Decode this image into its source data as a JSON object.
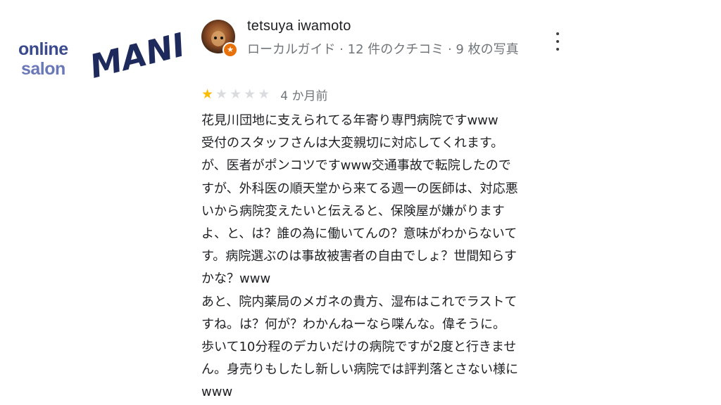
{
  "watermark": {
    "online": "online",
    "salon": "salon",
    "mania": "MANIA",
    "color_dark": "#1f2a5c",
    "color_mid": "#3a4a8c",
    "color_light": "#6a78b8"
  },
  "review": {
    "author": "tetsuya iwamoto",
    "meta": "ローカルガイド · 12 件のクチコミ · 9 枚の写真",
    "avatar_icon": "dog-photo-avatar",
    "badge_icon": "local-guide-star-icon",
    "menu_icon": "more-vert-icon",
    "rating": 1,
    "rating_max": 5,
    "date": "4 か月前",
    "star_color": "#fbbc04",
    "lines": [
      "花見川団地に支えられてる年寄り専門病院ですwww",
      "受付のスタッフさんは大変親切に対応してくれます。",
      "が、医者がポンコツですwww交通事故で転院したので",
      "すが、外科医の順天堂から来てる週一の医師は、対応悪",
      "いから病院変えたいと伝えると、保険屋が嫌がります",
      "よ、と、は？誰の為に働いてんの？意味がわからないて",
      "す。病院選ぶのは事故被害者の自由でしょ？世間知らす",
      "かな？www",
      "あと、院内薬局のメガネの貴方、湿布はこれでラストて",
      "すね。は？何が？わかんねーなら喋んな。偉そうに。",
      "歩いて10分程のデカいだけの病院ですが2度と行きませ",
      "ん。身売りもしたし新しい病院では評判落とさない様に",
      "www"
    ]
  }
}
